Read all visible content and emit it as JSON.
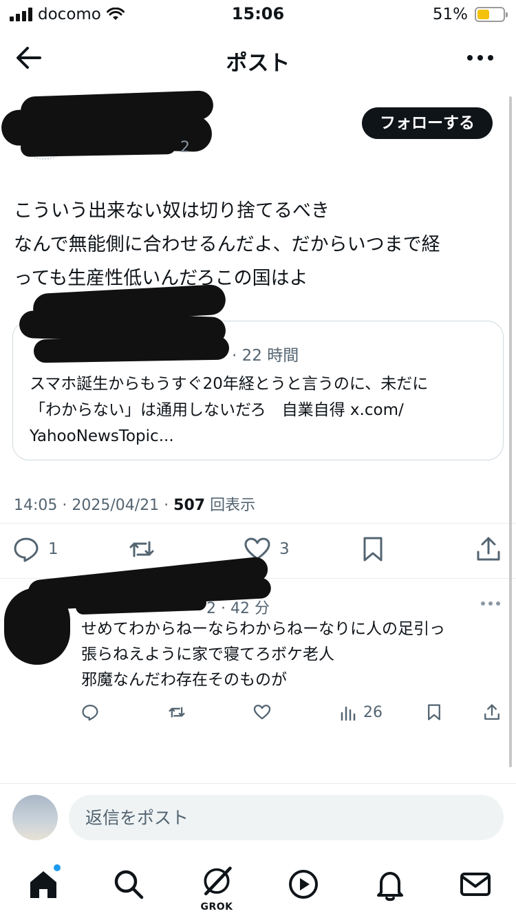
{
  "status_bar": {
    "carrier": "docomo",
    "time": "15:06",
    "battery_percent": "51%",
    "battery_level": 0.51
  },
  "header": {
    "title": "ポスト",
    "back_icon": "arrow-left-icon",
    "more_icon": "ellipsis-icon"
  },
  "author": {
    "follow_label": "フォローする",
    "handle_suffix": "2"
  },
  "post": {
    "text": "こういう出来ない奴は切り捨てるべき\nなんで無能側に合わせるんだよ、だからいつまで経\nっても生産性低いんだろこの国はよ",
    "timestamp": "14:05 · 2025/04/21 · ",
    "views_count": "507",
    "views_label": " 回表示"
  },
  "quote": {
    "time": "· 22 時間",
    "text": "スマホ誕生からもうすぐ20年経とうと言うのに、未だに\n「わからない」は通用しないだろ　自業自得 x.com/\nYahooNewsTopic..."
  },
  "actions": {
    "reply_count": "1",
    "repost_count": "",
    "like_count": "3"
  },
  "reply": {
    "time": "2 · 42 分",
    "text": "せめてわからねーならわからねーなりに人の足引っ\n張らねえように家で寝てろボケ老人\n邪魔なんだわ存在そのものが",
    "views_count": "26"
  },
  "reply_bar": {
    "placeholder": "返信をポスト"
  },
  "tab_bar": {
    "grok_label": "GROK",
    "accent_color": "#1d9bf0"
  }
}
